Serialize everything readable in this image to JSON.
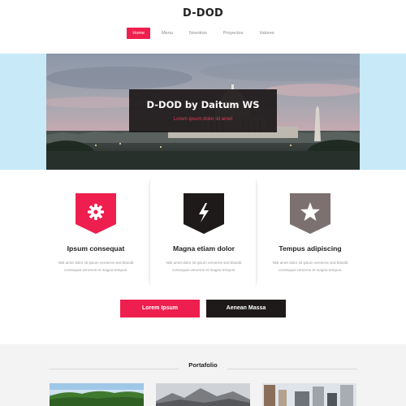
{
  "site": {
    "brand": "D-DOD"
  },
  "nav": {
    "items": [
      "Home",
      "Menu",
      "Nosotros",
      "Proyectos",
      "Valores"
    ],
    "active_index": 0
  },
  "hero": {
    "title": "D-DOD by Daitum WS",
    "subtitle": "Lorem ipsum dolor sit amet"
  },
  "features": [
    {
      "icon": "gear-icon",
      "badge_color": "#ee1f4e",
      "title": "Ipsum consequat",
      "text": "Nisl amet dolor sit ipsum veroeros sed blandit consequat veroeros et magna tempus."
    },
    {
      "icon": "lightning-icon",
      "badge_color": "#1e1a1a",
      "title": "Magna etiam dolor",
      "text": "Nisl amet dolor sit ipsum veroeros sed blandit consequat veroeros et magna tempus."
    },
    {
      "icon": "star-icon",
      "badge_color": "#7d7071",
      "title": "Tempus adipiscing",
      "text": "Nisl amet dolor sit ipsum veroeros sed blandit consequat veroeros et magna tempus."
    }
  ],
  "buttons": {
    "primary_label": "Lorem Ipsum",
    "secondary_label": "Aenean Massa"
  },
  "portfolio": {
    "title": "Portafolio"
  },
  "colors": {
    "accent": "#ee1f4e",
    "dark": "#1e1a1a",
    "muted": "#7d7071",
    "banner_bg": "#c7e9f8"
  }
}
